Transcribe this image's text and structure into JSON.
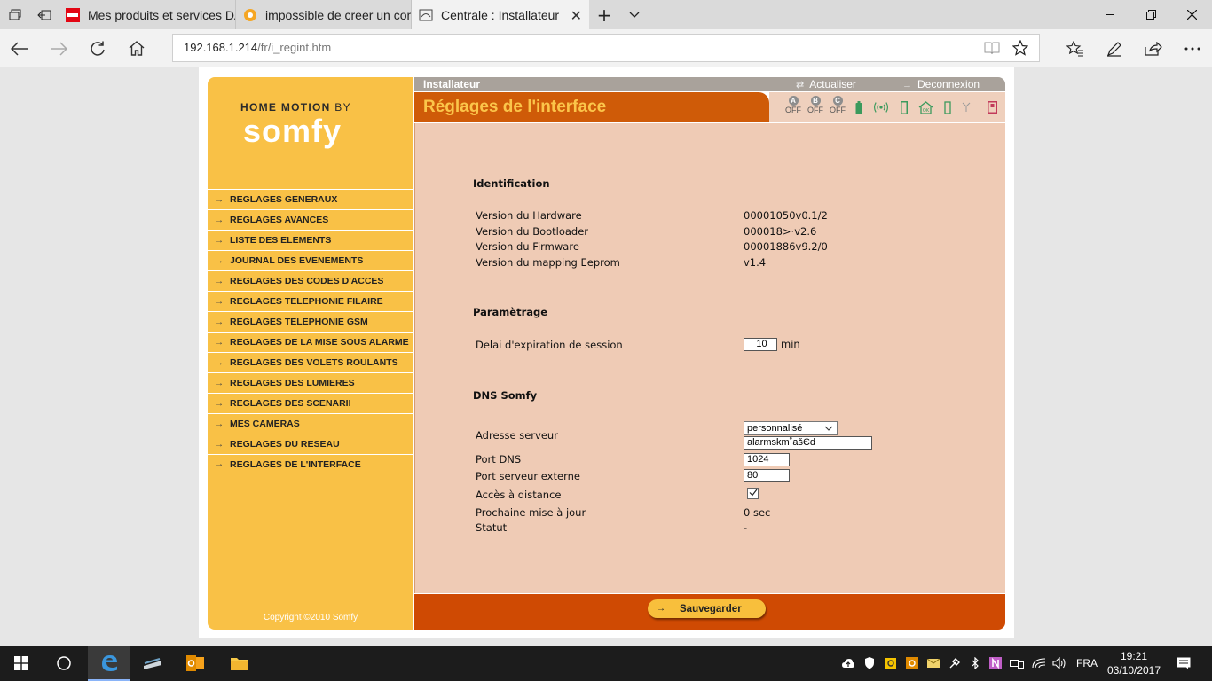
{
  "browser": {
    "tabs": [
      {
        "title": "Mes produits et services DA",
        "favicon": "darty-icon"
      },
      {
        "title": "impossible de creer un com",
        "favicon": "forum-icon"
      },
      {
        "title": "Centrale : Installateur",
        "favicon": "page-icon",
        "active": true
      }
    ],
    "address": {
      "host": "192.168.1.214",
      "path": "/fr/i_regint.htm"
    }
  },
  "app": {
    "brand_line1": "HOME MOTION",
    "brand_by": "BY",
    "brand_line2": "somfy",
    "copyright": "Copyright ©2010 Somfy",
    "role": "Installateur",
    "refresh_label": "Actualiser",
    "logout_label": "Deconnexion",
    "page_title": "Réglages de l'interface",
    "zones": [
      {
        "letter": "A",
        "state": "OFF"
      },
      {
        "letter": "B",
        "state": "OFF"
      },
      {
        "letter": "C",
        "state": "OFF"
      }
    ],
    "status_icons": [
      "battery-icon",
      "radio-icon",
      "box-icon",
      "house-ok-icon",
      "battery-small-icon",
      "antenna-icon",
      "tamper-icon"
    ],
    "accent_color": "#cf5b08",
    "sidebar_color": "#f9c146"
  },
  "menu": [
    "REGLAGES GENERAUX",
    "REGLAGES AVANCES",
    "LISTE DES ELEMENTS",
    "JOURNAL DES EVENEMENTS",
    "REGLAGES DES CODES D'ACCES",
    "REGLAGES TELEPHONIE FILAIRE",
    "REGLAGES TELEPHONIE GSM",
    "REGLAGES DE LA MISE SOUS ALARME",
    "REGLAGES DES VOLETS ROULANTS",
    "REGLAGES DES LUMIERES",
    "REGLAGES DES SCENARII",
    "MES CAMERAS",
    "REGLAGES DU RESEAU",
    "REGLAGES DE L'INTERFACE"
  ],
  "identification": {
    "heading": "Identification",
    "rows": [
      {
        "label": "Version du Hardware",
        "value": "00001050v0.1/2"
      },
      {
        "label": "Version du Bootloader",
        "value": "000018>·v2.6"
      },
      {
        "label": "Version du Firmware",
        "value": "00001886v9.2/0"
      },
      {
        "label": "Version du mapping Eeprom",
        "value": "v1.4"
      }
    ]
  },
  "parametrage": {
    "heading": "Paramètrage",
    "session_label": "Delai d'expiration de session",
    "session_value": "10",
    "session_unit": "min"
  },
  "dns": {
    "heading": "DNS Somfy",
    "server_label": "Adresse serveur",
    "server_select": "personnalisé",
    "server_value": "alarmskm˚ašЄd",
    "port_dns_label": "Port DNS",
    "port_dns_value": "1024",
    "port_ext_label": "Port serveur externe",
    "port_ext_value": "80",
    "remote_label": "Accès à distance",
    "remote_checked": true,
    "next_update_label": "Prochaine mise à jour",
    "next_update_value": "0 sec",
    "status_label": "Statut",
    "status_value": "-"
  },
  "save_label": "Sauvegarder",
  "taskbar": {
    "lang": "FRA",
    "time": "19:21",
    "date": "03/10/2017"
  }
}
